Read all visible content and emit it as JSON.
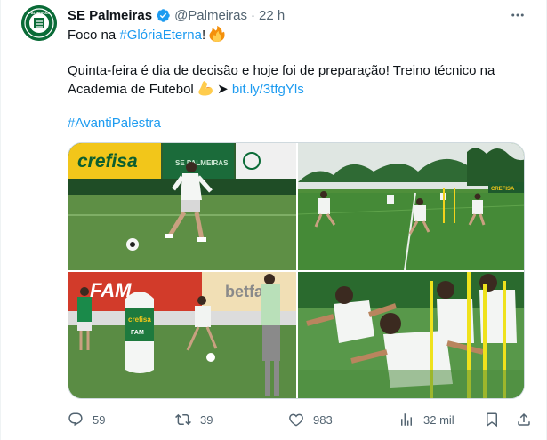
{
  "author": {
    "name": "SE Palmeiras",
    "handle": "@Palmeiras",
    "separator": "·",
    "time": "22 h",
    "verified": true,
    "avatar_icon": "palmeiras-crest",
    "avatar_color": "#0a6b37",
    "avatar_text": "PALMEIRAS"
  },
  "tweet": {
    "line1_prefix": "Foco na ",
    "line1_hashtag": "#GlóriaEterna",
    "line1_suffix": "!",
    "line1_emoji": "fire-emoji",
    "line2": "Quinta-feira é dia de decisão e hoje foi de preparação! Treino técnico na",
    "line3_prefix": "Academia de Futebol",
    "line3_emoji": "flexed-biceps-emoji",
    "line3_arrow": "➤",
    "line3_link": "bit.ly/3tfgYls",
    "line4_hashtag": "#AvantiPalestra",
    "link_color": "#1d9bf0"
  },
  "media": {
    "photos": [
      {
        "description_icon": "player-kicking-ball-photo",
        "board_text": "crefisa",
        "board2_text": "SE PALMEIRAS"
      },
      {
        "description_icon": "team-training-field-photo",
        "board_text": "CREFISA"
      },
      {
        "description_icon": "player-with-dummy-photo",
        "board_text": "FAM",
        "board2_text": "betfa",
        "dummy_text": "crefisa",
        "dummy_text2": "FAM"
      },
      {
        "description_icon": "players-sprinting-photo"
      }
    ]
  },
  "actions": {
    "replies": "59",
    "reposts": "39",
    "likes": "983",
    "views": "32 mil"
  },
  "colors": {
    "text": "#0f1419",
    "muted": "#536471",
    "grass": "#4f8f3a",
    "palmeiras_green": "#0a6b37"
  }
}
